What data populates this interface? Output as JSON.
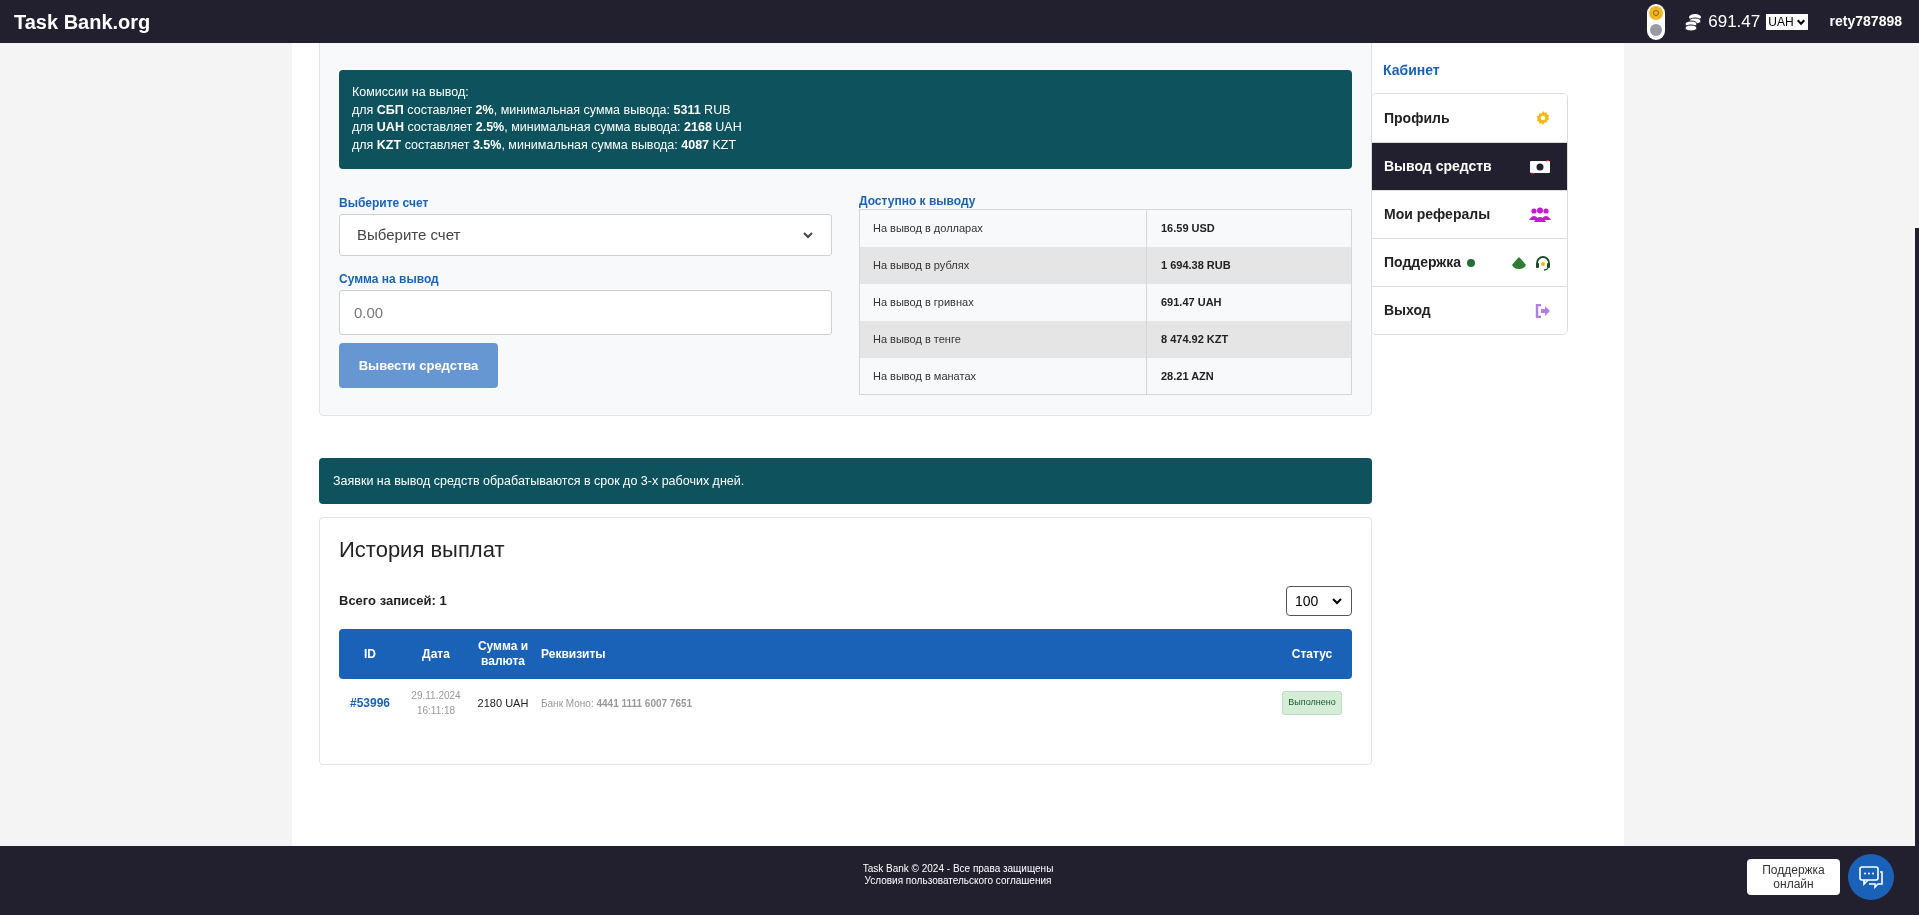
{
  "header": {
    "logo": "Task Bank.org",
    "balance": "691.47",
    "currency": "UAH",
    "username": "rety787898"
  },
  "withdraw": {
    "notice_lines": [
      "Комиссии на вывод:",
      "для **СБП** составляет **2%**, минимальная сумма вывода: **5311** RUB",
      "для **UAH** составляет **2.5%**, минимальная сумма вывода: **2168** UAH",
      "для **KZT** составляет **3.5%**, минимальная сумма вывода: **4087** KZT"
    ],
    "account_label": "Выберите счет",
    "account_select": "Выберите счет",
    "amount_label": "Сумма на вывод",
    "amount_placeholder": "0.00",
    "submit": {
      "label": "Вывести средства",
      "disabled": true
    },
    "available_title": "Доступно к выводу",
    "available_rows": [
      {
        "label": "На вывод в долларах",
        "value": "16.59 USD"
      },
      {
        "label": "На вывод в рублях",
        "value": "1 694.38 RUB"
      },
      {
        "label": "На вывод в гривнах",
        "value": "691.47 UAH"
      },
      {
        "label": "На вывод в тенге",
        "value": "8 474.92 KZT"
      },
      {
        "label": "На вывод в манатах",
        "value": "28.21 AZN"
      }
    ]
  },
  "processing_notice": "Заявки на вывод средств обрабатываются в срок до 3-х рабочих дней.",
  "history": {
    "title": "История выплат",
    "total": "Всего записей: 1",
    "page_size": "100",
    "columns": [
      "ID",
      "Дата",
      "Сумма и валюта",
      "Реквизиты",
      "Статус"
    ],
    "rows": [
      {
        "id": "#53996",
        "date": "29.11.2024",
        "time": "16:11:18",
        "amount": "2180 UAH",
        "details": "Банк Моно: **4441 1111 6007 7651**",
        "status": "Выполнено"
      }
    ]
  },
  "sidebar": {
    "title": "Кабинет",
    "items": [
      {
        "kind": "profile",
        "label": "Профиль",
        "selected": false
      },
      {
        "kind": "withdraw",
        "label": "Вывод средств",
        "selected": true
      },
      {
        "kind": "referrals",
        "label": "Мои рефералы",
        "selected": false
      },
      {
        "kind": "support",
        "label": "Поддержка",
        "selected": false,
        "online": true
      },
      {
        "kind": "logout",
        "label": "Выход",
        "selected": false
      }
    ]
  },
  "footer": {
    "copyright": "Task Bank © 2024 - Все права защищены",
    "terms_link": "Условия пользовательского соглашения"
  },
  "chat_widget": {
    "label": "Поддержка онлайн"
  }
}
